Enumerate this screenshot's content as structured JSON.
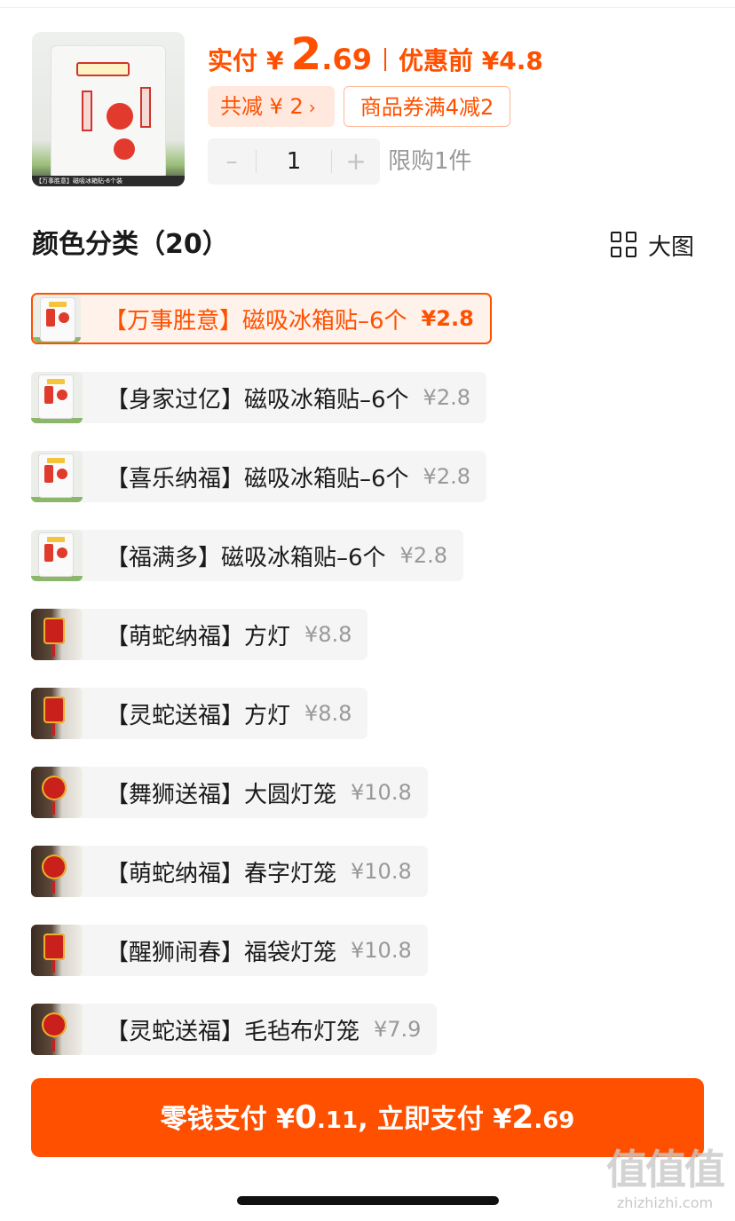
{
  "product": {
    "thumb_caption": "【万事胜意】磁吸冰箱贴-6个装",
    "thumb_sign_text": "万事胜意",
    "price_label": "实付",
    "currency": "¥",
    "price_int": "2",
    "price_dec": ".69",
    "original_label": "优惠前 ¥4.8",
    "discount_chip": "共减 ¥ 2",
    "coupon_chip": "商品券满4减2",
    "quantity": "1",
    "limit_text": "限购1件"
  },
  "section": {
    "title": "颜色分类（20）",
    "view_toggle_label": "大图",
    "view_toggle_icon": "grid-icon"
  },
  "variants": [
    {
      "label": "【万事胜意】磁吸冰箱贴–6个",
      "price": "¥2.8",
      "selected": true,
      "thumb": "fridge"
    },
    {
      "label": "【身家过亿】磁吸冰箱贴–6个",
      "price": "¥2.8",
      "selected": false,
      "thumb": "fridge"
    },
    {
      "label": "【喜乐纳福】磁吸冰箱贴–6个",
      "price": "¥2.8",
      "selected": false,
      "thumb": "fridge"
    },
    {
      "label": "【福满多】磁吸冰箱贴–6个",
      "price": "¥2.8",
      "selected": false,
      "thumb": "fridge"
    },
    {
      "label": "【萌蛇纳福】方灯",
      "price": "¥8.8",
      "selected": false,
      "thumb": "lamp"
    },
    {
      "label": "【灵蛇送福】方灯",
      "price": "¥8.8",
      "selected": false,
      "thumb": "lamp"
    },
    {
      "label": "【舞狮送福】大圆灯笼",
      "price": "¥10.8",
      "selected": false,
      "thumb": "lamp-round"
    },
    {
      "label": "【萌蛇纳福】春字灯笼",
      "price": "¥10.8",
      "selected": false,
      "thumb": "lamp-round"
    },
    {
      "label": "【醒狮闹春】福袋灯笼",
      "price": "¥10.8",
      "selected": false,
      "thumb": "lamp"
    },
    {
      "label": "【灵蛇送福】毛毡布灯笼",
      "price": "¥7.9",
      "selected": false,
      "thumb": "lamp-round"
    }
  ],
  "pay_button": {
    "part1": "零钱支付 ¥",
    "amount1_int": "0",
    "amount1_dec": ".11",
    "part2": ", 立即支付 ¥",
    "amount2_int": "2",
    "amount2_dec": ".69"
  },
  "watermark": {
    "logo": "值值值",
    "url": "zhizhizhi.com"
  },
  "colors": {
    "accent": "#ff5000",
    "chip_bg": "#ffe9de",
    "muted": "#999999"
  }
}
